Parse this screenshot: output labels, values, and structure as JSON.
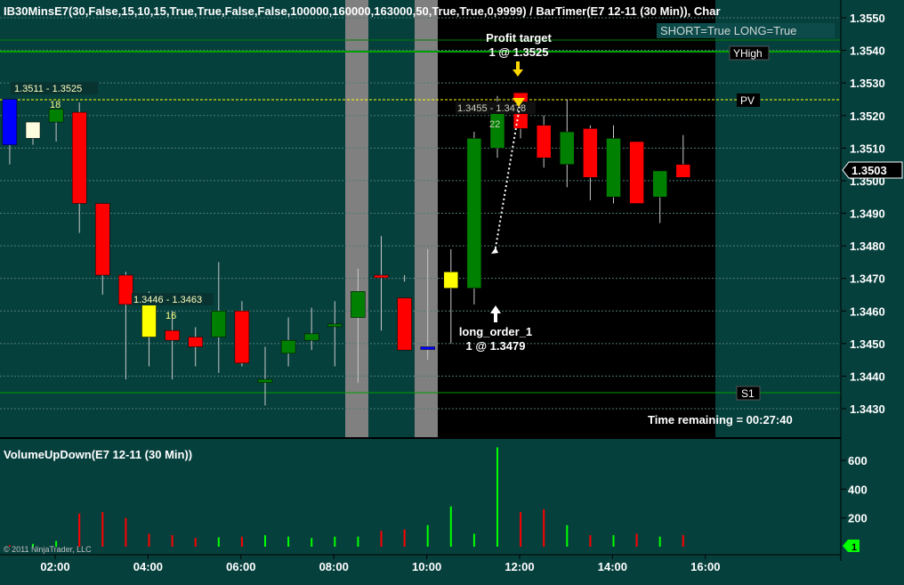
{
  "header": {
    "title": "IB30MinsE7(30,False,15,10,15,True,True,False,False,100000,160000,163000,50,True,True,0,9999)  /  BarTimer(E7  12-11  (30  Min)),  Char",
    "mode_badge": "SHORT=True LONG=True"
  },
  "price_axis": {
    "ticks": [
      "1.3550",
      "1.3540",
      "1.3530",
      "1.3520",
      "1.3510",
      "1.3500",
      "1.3490",
      "1.3480",
      "1.3470",
      "1.3460",
      "1.3450",
      "1.3440",
      "1.3430"
    ],
    "current_price": "1.3503"
  },
  "levels": {
    "yhigh_label": "YHigh",
    "pv_label": "PV",
    "s1_label": "S1",
    "range_label_1": "1.3511 - 1.3525",
    "range_label_2": "1.3446 - 1.3463",
    "range_label_3": "1.3455 - 1.3478",
    "count_1": "18",
    "count_2": "16",
    "count_3": "22"
  },
  "annotations": {
    "profit_target_title": "Profit target",
    "profit_target_detail": "1 @ 1.3525",
    "long_order_title": "long_order_1",
    "long_order_detail": "1 @ 1.3479",
    "time_remaining": "Time remaining = 00:27:40"
  },
  "volume_panel": {
    "title": "VolumeUpDown(E7 12-11 (30 Min))",
    "ticks": [
      "600",
      "400",
      "200"
    ],
    "badge": "1",
    "copyright": "© 2011 NinjaTrader, LLC"
  },
  "time_axis": {
    "ticks": [
      "02:00",
      "04:00",
      "06:00",
      "08:00",
      "10:00",
      "12:00",
      "14:00",
      "16:00"
    ]
  },
  "colors": {
    "background": "#06403d",
    "up_candle": "#008000",
    "down_candle": "#ff0000",
    "volume_up": "#00ff00",
    "volume_down": "#ff0000",
    "session_shade": "#000000",
    "blue_candle": "#0000ff",
    "yellow_candle": "#ffff00"
  },
  "chart_data": {
    "type": "candlestick",
    "x": [
      "01:30",
      "02:00",
      "02:30",
      "03:00",
      "03:30",
      "04:00",
      "04:30",
      "05:00",
      "05:30",
      "06:00",
      "06:30",
      "07:00",
      "07:30",
      "08:00",
      "08:30",
      "09:00",
      "09:30",
      "10:00",
      "10:30",
      "11:00",
      "11:30",
      "12:00",
      "12:30",
      "13:00",
      "13:30",
      "14:00",
      "14:30",
      "15:00",
      "15:30",
      "16:00"
    ],
    "open": [
      1.3525,
      1.3513,
      1.3518,
      1.3521,
      1.3493,
      1.3471,
      1.3462,
      1.3454,
      1.3452,
      1.3452,
      1.346,
      1.3438,
      1.3447,
      1.3451,
      1.3456,
      1.3458,
      1.3471,
      1.3464,
      1.3449,
      1.3472,
      1.3467,
      1.351,
      1.3527,
      1.3517,
      1.3505,
      1.3516,
      1.3513,
      1.3512,
      1.3495,
      1.3505
    ],
    "high": [
      1.3525,
      1.3518,
      1.3522,
      1.3524,
      1.3491,
      1.3472,
      1.3466,
      1.346,
      1.3455,
      1.3475,
      1.3463,
      1.3449,
      1.3458,
      1.3461,
      1.3463,
      1.3473,
      1.3483,
      1.3471,
      1.3479,
      1.3479,
      1.3515,
      1.3526,
      1.3527,
      1.352,
      1.3525,
      1.3517,
      1.3517,
      1.3512,
      1.35,
      1.3514
    ],
    "low": [
      1.3505,
      1.3511,
      1.3512,
      1.3484,
      1.3465,
      1.3439,
      1.3443,
      1.3439,
      1.3443,
      1.3441,
      1.3443,
      1.3431,
      1.3443,
      1.3448,
      1.3443,
      1.3438,
      1.3454,
      1.3469,
      1.3445,
      1.345,
      1.3462,
      1.3507,
      1.3513,
      1.3504,
      1.3498,
      1.3494,
      1.3493,
      1.3496,
      1.3487,
      1.3502
    ],
    "close": [
      1.3511,
      1.3518,
      1.3522,
      1.3493,
      1.3471,
      1.3462,
      1.3452,
      1.3451,
      1.3449,
      1.346,
      1.3444,
      1.3439,
      1.3451,
      1.3453,
      1.3456,
      1.3466,
      1.3471,
      1.3448,
      1.3449,
      1.3467,
      1.3513,
      1.3523,
      1.3516,
      1.3507,
      1.3515,
      1.3501,
      1.3495,
      1.3493,
      1.3503,
      1.3501
    ],
    "colors": [
      "blue",
      "beige",
      "up",
      "down",
      "down",
      "down",
      "yellow",
      "down",
      "down",
      "up",
      "down",
      "up",
      "up",
      "up",
      "up",
      "up",
      "down",
      "down",
      "blue",
      "yellow",
      "up",
      "up",
      "down",
      "down",
      "up",
      "down",
      "up",
      "down",
      "up",
      "down"
    ],
    "volume": [
      10,
      20,
      40,
      230,
      240,
      200,
      90,
      80,
      60,
      65,
      70,
      80,
      70,
      60,
      70,
      70,
      110,
      120,
      150,
      280,
      90,
      690,
      240,
      260,
      150,
      80,
      80,
      90,
      70,
      80,
      75
    ],
    "volume_dir": [
      "down",
      "up",
      "up",
      "down",
      "down",
      "down",
      "down",
      "down",
      "down",
      "up",
      "down",
      "up",
      "up",
      "up",
      "up",
      "up",
      "down",
      "down",
      "up",
      "up",
      "up",
      "up",
      "down",
      "down",
      "up",
      "down",
      "up",
      "down",
      "up",
      "down"
    ],
    "title": "IB30MinsE7",
    "ylim": [
      1.3422,
      1.3555
    ],
    "volume_ylim": [
      0,
      700
    ]
  }
}
